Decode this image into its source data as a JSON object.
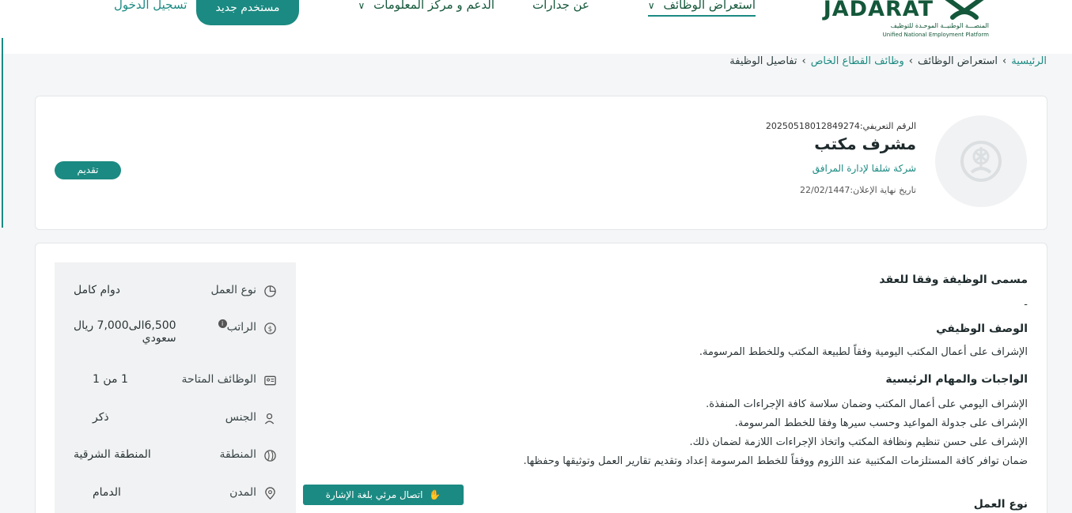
{
  "header": {
    "logo": {
      "wordmark": "JADARAT",
      "tagline_ar": "المنصـــة الوطنيــة الموحـدة للتوظيف",
      "tagline_en": "Unified National Employment Platform"
    },
    "nav": [
      {
        "label": "استعراض الوظائف",
        "has_dropdown": true,
        "active": true
      },
      {
        "label": "عن جدارات",
        "has_dropdown": false,
        "active": false
      },
      {
        "label": "الدعم و مركز المعلومات",
        "has_dropdown": true,
        "active": false
      }
    ],
    "register_label": "مستخدم جديد",
    "login_label": "تسجيل الدخول"
  },
  "breadcrumb": [
    {
      "label": "الرئيسية",
      "link": true
    },
    {
      "label": "استعراض الوظائف",
      "link": false
    },
    {
      "label": "وظائف القطاع الخاص",
      "link": true
    },
    {
      "label": "تفاصيل الوظيفة",
      "link": false
    }
  ],
  "job": {
    "id_text": "الرقم التعريفي:20250518012849274",
    "title": "مشرف مكتب",
    "company": "شركة شلفا لإدارة المرافق",
    "deadline": "تاريخ نهاية الإعلان:22/02/1447",
    "apply_label": "تقديم"
  },
  "details": {
    "contract_title_heading": "مسمى الوظيفة وفقا للعقد",
    "contract_title_value": "-",
    "description_heading": "الوصف الوظيفي",
    "description": "الإشراف على أعمال المكتب اليومية وفقاً لطبيعة المكتب وللخطط المرسومة.",
    "duties_heading": "الواجبات والمهام الرئيسية",
    "duties": [
      "الإشراف اليومي على أعمال المكتب وضمان سلاسة كافة الإجراءات المنفذة.",
      "الإشراف على جدولة المواعيد وحسب سيرها وفقا للخطط المرسومة.",
      "الإشراف على حسن تنظيم ونظافة المكتب واتخاذ الإجراءات اللازمة لضمان ذلك.",
      "ضمان توافر كافة المستلزمات المكتبية عند اللزوم ووفقاً للخطط المرسومة إعداد وتقديم تقارير العمل وتوثيقها وحفظها."
    ],
    "sign_language_label": "اتصال مرئي بلغة الإشارة",
    "next_heading": "نوع العمل"
  },
  "side": [
    {
      "label": "نوع العمل",
      "icon": "pie-chart-icon",
      "value": "دوام كامل"
    },
    {
      "label": "الراتب",
      "icon": "money-icon",
      "value": "6,500الى7,000 ريال",
      "value2": "سعودي",
      "info": "i"
    },
    {
      "label": "الوظائف المتاحة",
      "icon": "id-card-icon",
      "value": "1 من 1"
    },
    {
      "label": "الجنس",
      "icon": "person-icon",
      "value": "ذكر"
    },
    {
      "label": "المنطقة",
      "icon": "region-map-icon",
      "value": "المنطقة الشرقية"
    },
    {
      "label": "المدن",
      "icon": "location-pin-icon",
      "value": "الدمام"
    }
  ],
  "colors": {
    "primary": "#1b8a82",
    "dark_green": "#14573a",
    "panel": "#f1f2f3"
  }
}
